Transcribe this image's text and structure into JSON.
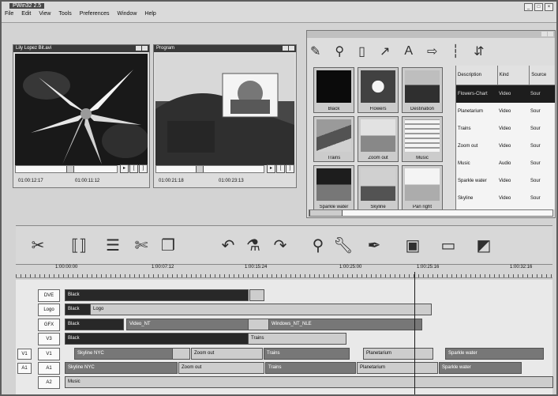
{
  "app": {
    "title": "PWin32 2.5"
  },
  "menus": [
    "File",
    "Edit",
    "View",
    "Tools",
    "Preferences",
    "Window",
    "Help"
  ],
  "viewer_left": {
    "title": "Lily Lopez Bit.avi",
    "timecodes": [
      "01:00:12:17",
      "01:00:11:12"
    ]
  },
  "viewer_right": {
    "title": "Program",
    "timecodes": [
      "01:00:21:18",
      "01:00:23:13"
    ]
  },
  "library": {
    "thumbnails": [
      "Black",
      "Flowers",
      "Destination",
      "Trains",
      "Zoom out",
      "Music",
      "Sparkle water",
      "Skyline",
      "Pan right"
    ],
    "columns": [
      "Description",
      "Kind",
      "Source"
    ],
    "rows": [
      {
        "description": "Flowers-Chart",
        "kind": "Video",
        "source": "Sour"
      },
      {
        "description": "Planetarium",
        "kind": "Video",
        "source": "Sour"
      },
      {
        "description": "Trains",
        "kind": "Video",
        "source": "Sour"
      },
      {
        "description": "Zoom out",
        "kind": "Video",
        "source": "Sour"
      },
      {
        "description": "Music",
        "kind": "Audio",
        "source": "Sour"
      },
      {
        "description": "Sparkle water",
        "kind": "Video",
        "source": "Sour"
      },
      {
        "description": "Skyline",
        "kind": "Video",
        "source": "Sour"
      }
    ]
  },
  "ruler": {
    "ticks": [
      "1:00:00:00",
      "1:00:07:12",
      "1:00:15:24",
      "1:00:25:00",
      "1:00:25:16",
      "1:00:32:16"
    ]
  },
  "tracks": {
    "labels": [
      "DVE",
      "Logo",
      "GFX",
      "V3",
      "V1",
      "A1",
      "A2"
    ],
    "side_tags": [
      "V1",
      "A1"
    ],
    "clips": {
      "dve_black": "Black",
      "logo_black": "Black",
      "logo_clip": "Logo",
      "gfx_black": "Black",
      "gfx_video": "Video_NT",
      "gfx_windows": "Windows_NT_NLE",
      "v3_black": "Black",
      "v3_trains": "Trains",
      "v1_skyline": "Skyline NYC",
      "v1_zoom": "Zoom out",
      "v1_trains": "Trains",
      "v1_planet": "Planetarium",
      "v1_sparkle": "Sparkle water",
      "a1_skyline": "Skyline NYC",
      "a1_zoom": "Zoom out",
      "a1_trains": "Trains",
      "a1_planet": "Planetarium",
      "a1_sparkle": "Sparkle water",
      "a2_music": "Music"
    }
  }
}
